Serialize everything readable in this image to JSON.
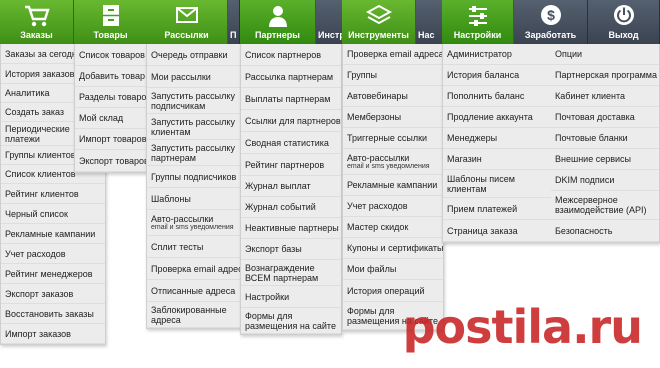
{
  "tabs": {
    "orders": "Заказы",
    "products": "Товары",
    "mailings": "Рассылки",
    "mailings_cut": "П",
    "partners": "Партнеры",
    "partners_cut": "Инстру",
    "tools": "Инструменты",
    "tools_cut": "Нас",
    "settings": "Настройки",
    "earn": "Заработать",
    "exit": "Выход"
  },
  "menus": {
    "orders": [
      "Заказы за сегодня",
      "История заказов",
      "Аналитика",
      "Создать заказ",
      "Периодические платежи",
      "Группы клиентов",
      "Список клиентов",
      "Рейтинг клиентов",
      "Черный список",
      "Рекламные кампании",
      "Учет расходов",
      "Рейтинг менеджеров",
      "Экспорт заказов",
      "Восстановить заказы",
      "Импорт заказов"
    ],
    "products": [
      "Список товаров",
      "Добавить товар",
      "Разделы товаров",
      "Мой склад",
      "Импорт товаров",
      "Экспорт товаров"
    ],
    "mailings": [
      "Очередь отправки",
      "Мои рассылки",
      "Запустить рассылку подписчикам",
      "Запустить рассылку клиентам",
      "Запустить рассылку партнерам",
      "Группы подписчиков",
      "Шаблоны",
      "Авто-рассылки",
      "email и sms уведомления",
      "Сплит тесты",
      "Проверка email адреса",
      "Отписанные адреса",
      "Заблокированные адреса"
    ],
    "partners": [
      "Список партнеров",
      "Рассылка партнерам",
      "Выплаты партнерам",
      "Ссылки для партнеров",
      "Сводная статистика",
      "Рейтинг партнеров",
      "Журнал выплат",
      "Журнал событий",
      "Неактивные партнеры",
      "Экспорт базы",
      "Вознаграждение ВСЕМ партнерам",
      "Настройки",
      "Формы для размещения на сайте"
    ],
    "tools": [
      "Проверка email адреса",
      "Группы",
      "Автовебинары",
      "Мемберзоны",
      "Триггерные ссылки",
      "Авто-рассылки",
      "email и sms уведомления",
      "Рекламные кампании",
      "Учет расходов",
      "Мастер скидок",
      "Купоны и сертификаты",
      "Мои файлы",
      "История операций",
      "Формы для размещения на сайте"
    ],
    "settings_left": [
      "Администратор",
      "История баланса",
      "Пополнить баланс",
      "Продление аккаунта",
      "Менеджеры",
      "Магазин",
      "Шаблоны писем клиентам",
      "Прием платежей",
      "Страница заказа"
    ],
    "settings_right": [
      "Опции",
      "Партнерская программа",
      "Кабинет клиента",
      "Почтовая доставка",
      "Почтовые бланки",
      "Внешние сервисы",
      "DKIM подписи",
      "Межсерверное взаимодействие (API)",
      "Безопасность"
    ]
  },
  "watermark": "postila.ru",
  "colors": {
    "green": "#4a9e1f",
    "dark": "#46505e",
    "menu_bg": "#ececec",
    "watermark": "#c82323"
  }
}
